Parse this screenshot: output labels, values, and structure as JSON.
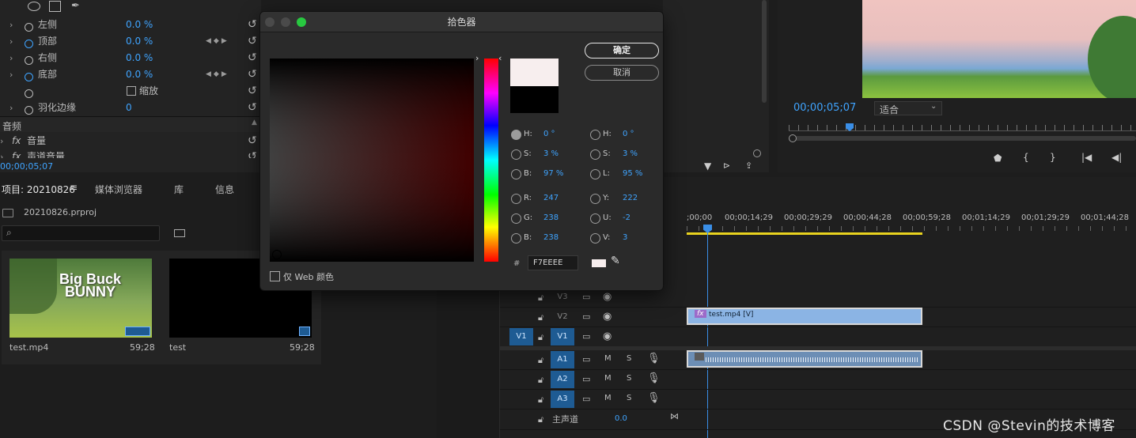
{
  "effects": {
    "rows": [
      {
        "label": "左侧",
        "value": "0.0 %"
      },
      {
        "label": "顶部",
        "value": "0.0 %"
      },
      {
        "label": "右侧",
        "value": "0.0 %"
      },
      {
        "label": "底部",
        "value": "0.0 %"
      },
      {
        "label": "缩放",
        "value": ""
      },
      {
        "label": "羽化边缘",
        "value": "0"
      }
    ],
    "audio_section": "音频",
    "audio_rows": [
      {
        "label": "音量"
      },
      {
        "label": "声道音量"
      }
    ],
    "timecode": "00;00;05;07"
  },
  "project": {
    "tabs": [
      "项目: 20210826",
      "媒体浏览器",
      "库",
      "信息"
    ],
    "filename": "20210826.prproj",
    "search_placeholder": "",
    "items": [
      {
        "name": "test.mp4",
        "duration": "59;28"
      },
      {
        "name": "test",
        "duration": "59;28"
      }
    ],
    "thumb_title_1": "Big Buck",
    "thumb_title_2": "BUNNY"
  },
  "program": {
    "timecode": "00;00;05;07",
    "fit_label": "适合"
  },
  "timeline": {
    "ruler": [
      ";00;00",
      "00;00;14;29",
      "00;00;29;29",
      "00;00;44;28",
      "00;00;59;28",
      "00;01;14;29",
      "00;01;29;29",
      "00;01;44;28"
    ],
    "video_tracks": [
      {
        "source": "",
        "name": "V3"
      },
      {
        "source": "",
        "name": "V2"
      },
      {
        "source": "V1",
        "name": "V1"
      }
    ],
    "audio_tracks": [
      {
        "name": "A1",
        "m": "M",
        "s": "S"
      },
      {
        "name": "A2",
        "m": "M",
        "s": "S"
      },
      {
        "name": "A3",
        "m": "M",
        "s": "S"
      }
    ],
    "master_label": "主声道",
    "master_value": "0.0",
    "clip_video_label": "test.mp4 [V]",
    "fx_badge": "fx"
  },
  "color_picker": {
    "title": "拾色器",
    "ok_label": "确定",
    "cancel_label": "取消",
    "web_only_label": "仅 Web 颜色",
    "hash": "#",
    "hex_value": "F7EEEE",
    "hsb": [
      {
        "label": "H:",
        "value": "0 °"
      },
      {
        "label": "S:",
        "value": "3 %"
      },
      {
        "label": "B:",
        "value": "97 %"
      }
    ],
    "hsl": [
      {
        "label": "H:",
        "value": "0 °"
      },
      {
        "label": "S:",
        "value": "3 %"
      },
      {
        "label": "L:",
        "value": "95 %"
      }
    ],
    "rgb": [
      {
        "label": "R:",
        "value": "247"
      },
      {
        "label": "G:",
        "value": "238"
      },
      {
        "label": "B:",
        "value": "238"
      }
    ],
    "yuv": [
      {
        "label": "Y:",
        "value": "222"
      },
      {
        "label": "U:",
        "value": "-2"
      },
      {
        "label": "V:",
        "value": "3"
      }
    ],
    "new_color": "#F7EEEE",
    "old_color": "#000000",
    "field_hue": "#FF0000"
  },
  "watermark": "CSDN @Stevin的技术博客"
}
